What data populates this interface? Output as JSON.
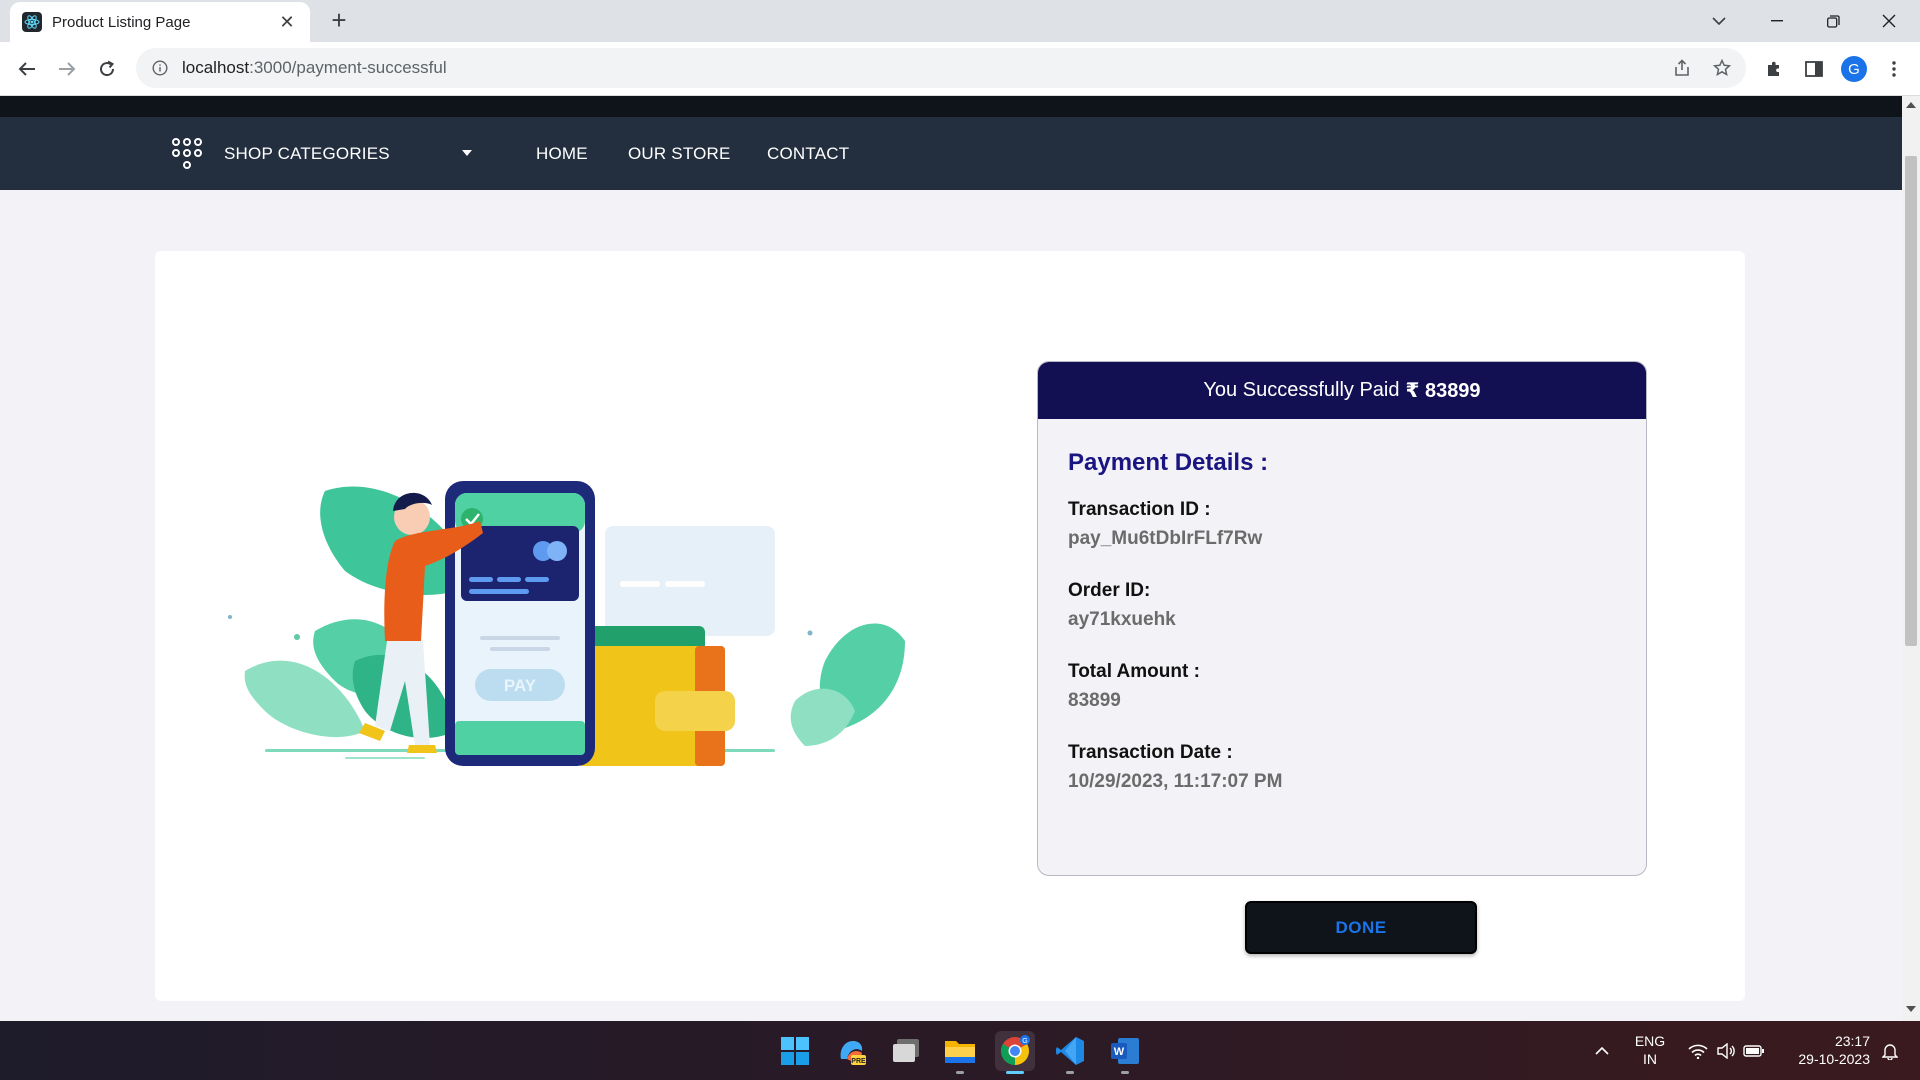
{
  "browser": {
    "tab_title": "Product Listing Page",
    "url_host": "localhost",
    "url_path": ":3000/payment-successful",
    "profile_initial": "G"
  },
  "nav": {
    "categories_label": "SHOP CATEGORIES",
    "links": [
      "HOME",
      "OUR STORE",
      "CONTACT"
    ]
  },
  "illustration": {
    "pay_label": "PAY"
  },
  "payment": {
    "header_text": "You Successfully Paid",
    "header_amount": "₹ 83899",
    "details_title": "Payment Details :",
    "fields": [
      {
        "label": "Transaction ID :",
        "value": "pay_Mu6tDbIrFLf7Rw"
      },
      {
        "label": "Order ID:",
        "value": "ay71kxuehk"
      },
      {
        "label": "Total Amount :",
        "value": "83899"
      },
      {
        "label": "Transaction Date :",
        "value": "10/29/2023, 11:17:07 PM"
      }
    ],
    "done_label": "DONE"
  },
  "taskbar": {
    "lang_top": "ENG",
    "lang_bottom": "IN",
    "time": "23:17",
    "date": "29-10-2023",
    "icons": [
      "windows-start",
      "copilot-pre",
      "task-view",
      "file-explorer",
      "chrome",
      "vscode",
      "word"
    ]
  },
  "colors": {
    "navbar": "#232f3e",
    "header_bg": "#120f52",
    "details_title": "#1a1580",
    "done_text": "#1a73e8"
  }
}
